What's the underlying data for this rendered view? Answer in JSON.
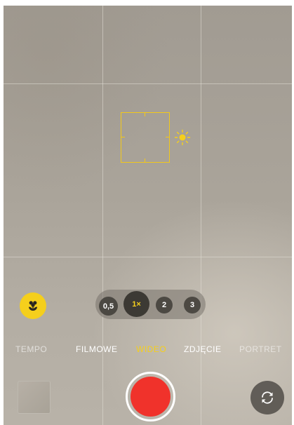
{
  "camera": {
    "zoom": {
      "options": [
        "0,5",
        "1×",
        "2",
        "3"
      ],
      "selected": "1×"
    },
    "modes": [
      "TEMPO",
      "FILMOWE",
      "WIDEO",
      "ZDJĘCIE",
      "PORTRET"
    ],
    "selected_mode": "WIDEO",
    "icons": {
      "macro": "flower-icon",
      "exposure": "sun-icon",
      "flip": "camera-flip-icon"
    },
    "colors": {
      "accent": "#f5cf1c",
      "record": "#f0322b"
    }
  }
}
